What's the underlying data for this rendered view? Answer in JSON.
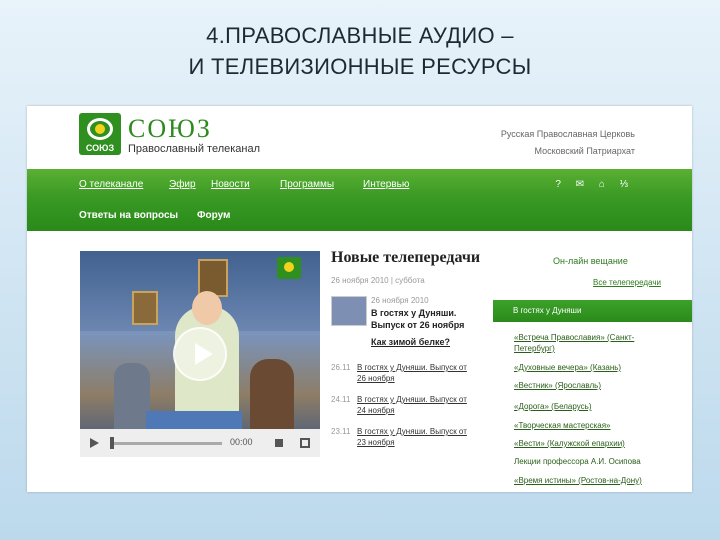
{
  "slide": {
    "title_line1": "4.ПРАВОСЛАВНЫЕ  АУДИО –",
    "title_line2": "И ТЕЛЕВИЗИОННЫЕ РЕСУРСЫ"
  },
  "site": {
    "logo_caption": "СОЮЗ",
    "brand": "СОЮЗ",
    "tagline": "Православный телеканал",
    "church_line1": "Русская Православная Церковь",
    "church_line2": "Московский Патриархат"
  },
  "nav": {
    "items": [
      "О телеканале",
      "Эфир",
      "Новости",
      "Программы",
      "Интервью"
    ],
    "row2": [
      "Ответы на вопросы",
      "Форум"
    ],
    "tools": "? ✉ ⌂ ⅓"
  },
  "video": {
    "time": "00:00"
  },
  "main": {
    "title": "Новые телепередачи",
    "date": "26 ноября 2010 | суббота",
    "featured": {
      "date": "26 ноября 2010",
      "title": "В гостях у Дуняши. Выпуск от 26 ноября",
      "link": "Как зимой белке?"
    },
    "episodes": [
      {
        "date": "26.11",
        "text": "В гостях у Дуняши. Выпуск от 26 ноября"
      },
      {
        "date": "24.11",
        "text": "В гостях у Дуняши. Выпуск от 24 ноября"
      },
      {
        "date": "23.11",
        "text": "В гостях у Дуняши. Выпуск от 23 ноября"
      }
    ]
  },
  "right": {
    "online": "Он-лайн вещание",
    "all_shows": "Все телепередачи",
    "active": "В гостях у Дуняши",
    "items": [
      "«Встреча Православия» (Санкт-Петербург)",
      "«Духовные вечера» (Казань)",
      "«Вестник» (Ярославль)",
      "«Дорога» (Беларусь)",
      "«Творческая мастерская»",
      "«Вести» (Калужской епархии)",
      "Лекции профессора А.И. Осипова",
      "«Время истины» (Ростов-на-Дону)"
    ]
  }
}
